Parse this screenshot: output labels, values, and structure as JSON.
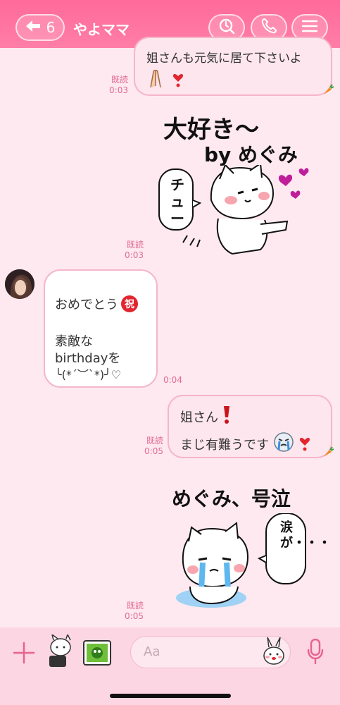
{
  "header": {
    "back_count": "6",
    "title": "やよママ"
  },
  "messages": {
    "m1": {
      "text": "姐さんも元気に居て下さいよ",
      "read": "既読",
      "time": "0:03"
    },
    "s1": {
      "line1": "大好き〜",
      "line2": "by めぐみ",
      "bubble": "チュー",
      "read": "既読",
      "time": "0:03"
    },
    "m2": {
      "line1": "おめでとう",
      "stamp": "祝",
      "line2": "素敵な",
      "line3": "birthdayを",
      "line4": "╰(*´︶`*)╯♡",
      "time": "0:04"
    },
    "m3": {
      "line1": "姐さん",
      "line2": "まじ有難うです",
      "read": "既読",
      "time": "0:05"
    },
    "s2": {
      "line1": "めぐみ、号泣",
      "bubble": "涙が・・・",
      "read": "既読",
      "time": "0:05"
    }
  },
  "input": {
    "placeholder": "Aa"
  },
  "colors": {
    "header": "#ff6f9e",
    "background": "#fde9ef",
    "accent": "#e36a93"
  }
}
